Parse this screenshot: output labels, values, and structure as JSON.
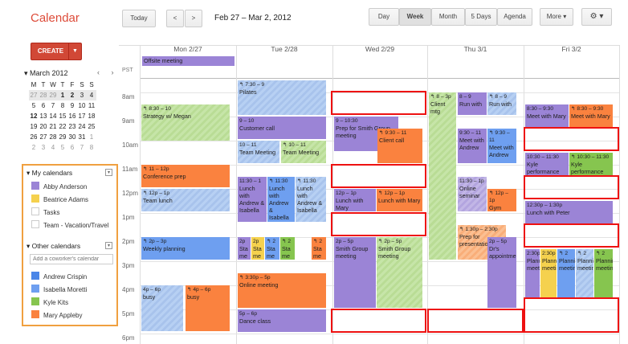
{
  "app_title": "Calendar",
  "toolbar": {
    "today": "Today",
    "prev": "<",
    "next": ">",
    "date_range": "Feb 27 – Mar 2, 2012",
    "views": [
      "Day",
      "Week",
      "Month",
      "5 Days",
      "Agenda"
    ],
    "more": "More ▾",
    "settings": "⚙ ▾"
  },
  "create": {
    "label": "CREATE",
    "drop": "▼"
  },
  "mini": {
    "title": "▾ March 2012",
    "nav": "‹ ›",
    "headers": [
      "M",
      "T",
      "W",
      "T",
      "F",
      "S",
      "S"
    ],
    "weeks": [
      [
        "27",
        "28",
        "29",
        "1",
        "2",
        "3",
        "4"
      ],
      [
        "5",
        "6",
        "7",
        "8",
        "9",
        "10",
        "11"
      ],
      [
        "12",
        "13",
        "14",
        "15",
        "16",
        "17",
        "18"
      ],
      [
        "19",
        "20",
        "21",
        "22",
        "23",
        "24",
        "25"
      ],
      [
        "26",
        "27",
        "28",
        "29",
        "30",
        "31",
        "1"
      ],
      [
        "2",
        "3",
        "4",
        "5",
        "6",
        "7",
        "8"
      ]
    ]
  },
  "my_cals": {
    "title": "▾ My calendars",
    "items": [
      {
        "label": "Abby Anderson",
        "color": "#9b84d6"
      },
      {
        "label": "Beatrice Adams",
        "color": "#f5d14e"
      },
      {
        "label": "Tasks",
        "color": "#ffffff"
      },
      {
        "label": "Team - Vacation/Travel",
        "color": "#ffffff"
      }
    ]
  },
  "other_cals": {
    "title": "▾ Other calendars",
    "placeholder": "Add a coworker's calendar",
    "items": [
      {
        "label": "Andrew Crispin",
        "color": "#4a86e8"
      },
      {
        "label": "Isabella Moretti",
        "color": "#6e9ff0"
      },
      {
        "label": "Kyle Kits",
        "color": "#86c54f"
      },
      {
        "label": "Mary Appleby",
        "color": "#fa823f"
      }
    ]
  },
  "grid": {
    "pst": "PST",
    "days": [
      "Mon 2/27",
      "Tue 2/28",
      "Wed 2/29",
      "Thu 3/1",
      "Fri 3/2"
    ],
    "times": [
      "8am",
      "9am",
      "10am",
      "11am",
      "12pm",
      "1pm",
      "2pm",
      "3pm",
      "4pm",
      "5pm",
      "6pm"
    ]
  },
  "allday": [
    {
      "title": "Offsite meeting"
    }
  ],
  "events": [
    {
      "time": "↰ 8:30 – 10",
      "title": "Strategy w/ Megan"
    },
    {
      "time": "↰ 11 – 12p",
      "title": "Conference prep"
    },
    {
      "time": "↰ 12p – 1p",
      "title": "Team lunch"
    },
    {
      "time": "↰ 2p – 3p",
      "title": "Weekly planning"
    },
    {
      "time": "4p – 6p",
      "title": "busy"
    },
    {
      "time": "↰ 4p – 6p",
      "title": "busy"
    },
    {
      "time": "↰ 7:30 – 9",
      "title": "Pilates"
    },
    {
      "time": "9 – 10",
      "title": "Customer call"
    },
    {
      "time": "10 – 11",
      "title": "Team Meeting"
    },
    {
      "time": "↰ 10 – 11",
      "title": "Team Meeting"
    },
    {
      "time": "11:30 – 1",
      "title": "Lunch with Andrew & Isabella"
    },
    {
      "time": "↰ 11:30",
      "title": "Lunch with Andrew & Isabella"
    },
    {
      "time": "↰ 11:30",
      "title": "Lunch with Andrew & Isabella"
    },
    {
      "time": "2p",
      "title": "Sta me"
    },
    {
      "time": "2p",
      "title": "Sta me"
    },
    {
      "time": "↰ 2",
      "title": "Sta me"
    },
    {
      "time": "↰ 2",
      "title": "Sta me"
    },
    {
      "time": "↰ 2",
      "title": "Sta me"
    },
    {
      "time": "↰ 3:30p – 5p",
      "title": "Online meeting"
    },
    {
      "time": "5p – 6p",
      "title": "Dance class"
    },
    {
      "time": "9 – 10:30",
      "title": "Prep for Smith Group meeting"
    },
    {
      "time": "↰ 9:30 – 11",
      "title": "Client call"
    },
    {
      "time": "12p – 1p",
      "title": "Lunch with Mary"
    },
    {
      "time": "↰ 12p – 1p",
      "title": "Lunch with Mary"
    },
    {
      "time": "2p – 5p",
      "title": "Smith Group meeting"
    },
    {
      "time": "↰ 2p – 5p",
      "title": "Smith Group meeting"
    },
    {
      "time": "↰ 8 – 3p",
      "title": "Client mtg"
    },
    {
      "time": "8 – 9",
      "title": "Run with"
    },
    {
      "time": "↰ 8 – 9",
      "title": "Run with"
    },
    {
      "time": "9:30 – 11",
      "title": "Meet with Andrew"
    },
    {
      "time": "↰ 9:30 – 11",
      "title": "Meet with Andrew"
    },
    {
      "time": "11:30 – 1p",
      "title": "Online seminar"
    },
    {
      "time": "↰ 12p – 1p",
      "title": "Gym"
    },
    {
      "time": "↰ 1:30p – 2:30p",
      "title": "Prep for presentation"
    },
    {
      "time": "2p – 5p",
      "title": "Dr's appointment"
    },
    {
      "time": "8:30 – 9:30",
      "title": "Meet with Mary"
    },
    {
      "time": "↰ 8:30 – 9:30",
      "title": "Meet with Mary"
    },
    {
      "time": "10:30 – 11:30",
      "title": "Kyle performance review"
    },
    {
      "time": "↰ 10:30 – 11:30",
      "title": "Kyle performance review"
    },
    {
      "time": "12:30p – 1:30p",
      "title": "Lunch with Peter"
    },
    {
      "time": "2:30p",
      "title": "Planning meeting"
    },
    {
      "time": "2:30p",
      "title": "Planning meeting"
    },
    {
      "time": "↰ 2",
      "title": "Planning meeting"
    },
    {
      "time": "↰ 2",
      "title": "Planning meeting"
    },
    {
      "time": "↰ 2",
      "title": "Planning meeting"
    }
  ]
}
